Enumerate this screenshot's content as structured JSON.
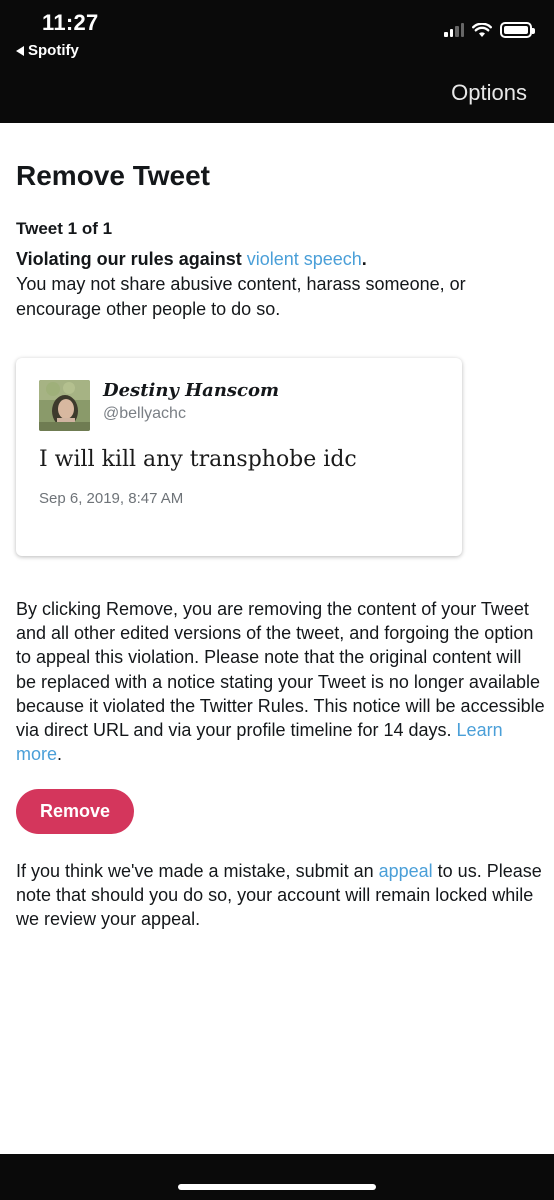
{
  "status_bar": {
    "time": "11:27",
    "back_app": "Spotify"
  },
  "nav": {
    "options_label": "Options"
  },
  "page": {
    "title": "Remove Tweet",
    "tweet_count": "Tweet 1 of 1",
    "violation_lead": "Violating our rules against ",
    "violation_link": "violent speech",
    "violation_period": ".",
    "violation_desc": "You may not share abusive content, harass someone, or encourage other people to do so."
  },
  "tweet": {
    "author": "Destiny Hanscom",
    "handle": "@bellyachc",
    "text": "I will kill any transphobe idc",
    "date": "Sep 6, 2019, 8:47 AM"
  },
  "explanation": {
    "text": "By clicking Remove, you are removing the content of your Tweet and all other edited versions of the tweet, and forgoing the option to appeal this violation. Please note that the original content will be replaced with a notice stating your Tweet is no longer available because it violated the Twitter Rules. This notice will be accessible via direct URL and via your profile timeline for 14 days. ",
    "link": "Learn more",
    "tail": "."
  },
  "remove_button": {
    "label": "Remove"
  },
  "appeal": {
    "pre": "If you think we've made a mistake, submit an ",
    "link": "appeal",
    "post": " to us. Please note that should you do so, your account will remain locked while we review your appeal."
  },
  "colors": {
    "link": "#4a9fd8",
    "remove_button": "#d4365c",
    "bars": "#0a0a0a"
  },
  "icons": [
    "back-arrow-icon",
    "cellular-signal-icon",
    "wifi-icon",
    "battery-icon"
  ]
}
